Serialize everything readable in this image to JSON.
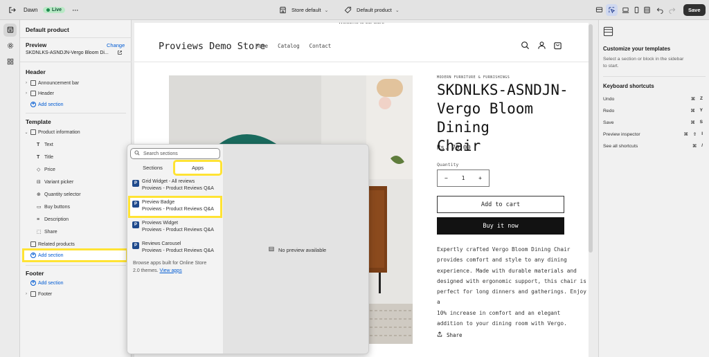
{
  "topbar": {
    "store_name": "Dawn",
    "live_badge": "Live",
    "theme_selector": "Store default",
    "template_selector": "Default product",
    "save_label": "Save"
  },
  "sidebar": {
    "title": "Default product",
    "preview_label": "Preview",
    "change_link": "Change",
    "preview_product": "SKDNLKS-ASNDJN-Vergo Bloom Di...",
    "header_section": "Header",
    "header_items": [
      "Announcement bar",
      "Header"
    ],
    "add_section": "Add section",
    "template_section": "Template",
    "product_info": "Product information",
    "blocks": [
      "Text",
      "Title",
      "Price",
      "Variant picker",
      "Quantity selector",
      "Buy buttons",
      "Description",
      "Share"
    ],
    "related_products": "Related products",
    "footer_section": "Footer",
    "footer_item": "Footer"
  },
  "store": {
    "announcement": "Welcome to our store",
    "logo": "Proviews Demo Store",
    "nav": [
      "Home",
      "Catalog",
      "Contact"
    ],
    "vendor": "MODERN FURNITURE & FURNISHINGS",
    "product_title": [
      "SKDNLKS-ASNDJN-",
      "Vergo Bloom Dining",
      "Chair"
    ],
    "price": "Rs. 79.00",
    "quantity_label": "Quantity",
    "quantity_value": "1",
    "minus": "−",
    "plus": "+",
    "add_to_cart": "Add to cart",
    "buy_now": "Buy it now",
    "description": [
      "Expertly crafted Vergo Bloom Dining Chair",
      "provides comfort and style to any dining",
      "experience. Made with durable materials and",
      "designed with ergonomic support, this chair is",
      "perfect for long dinners and gatherings. Enjoy a",
      "10% increase in comfort and an elegant",
      "addition to your dining room with Vergo."
    ],
    "share": "Share"
  },
  "picker": {
    "search_placeholder": "Search sections",
    "tabs": [
      "Sections",
      "Apps"
    ],
    "apps": [
      {
        "name": "Grid Widget - All reviews",
        "vendor": "Proviews - Product Reviews Q&A"
      },
      {
        "name": "Preview Badge",
        "vendor": "Proviews - Product Reviews Q&A"
      },
      {
        "name": "Proviews Widget",
        "vendor": "Proviews - Product Reviews Q&A"
      },
      {
        "name": "Reviews Carousel",
        "vendor": "Proviews - Product Reviews Q&A"
      }
    ],
    "footer_text_1": "Browse apps built for Online Store",
    "footer_text_2": "2.0 themes.",
    "view_apps": "View apps",
    "no_preview": "No preview available"
  },
  "right_panel": {
    "customize_title": "Customize your templates",
    "customize_text_1": "Select a section or block in the sidebar",
    "customize_text_2": "to start.",
    "shortcuts_title": "Keyboard shortcuts",
    "shortcuts": [
      {
        "label": "Undo",
        "keys": [
          "⌘",
          "Z"
        ]
      },
      {
        "label": "Redo",
        "keys": [
          "⌘",
          "Y"
        ]
      },
      {
        "label": "Save",
        "keys": [
          "⌘",
          "S"
        ]
      },
      {
        "label": "Preview inspector",
        "keys": [
          "⌘",
          "⇧",
          "I"
        ]
      },
      {
        "label": "See all shortcuts",
        "keys": [
          "⌘",
          "/"
        ]
      }
    ]
  },
  "colors": {
    "accent": "#005bd3",
    "highlight": "#ffe334",
    "live_bg": "#b9e9c6",
    "chair_teal": "#1a6b5e",
    "cabinet_wood": "#7a3f17"
  }
}
